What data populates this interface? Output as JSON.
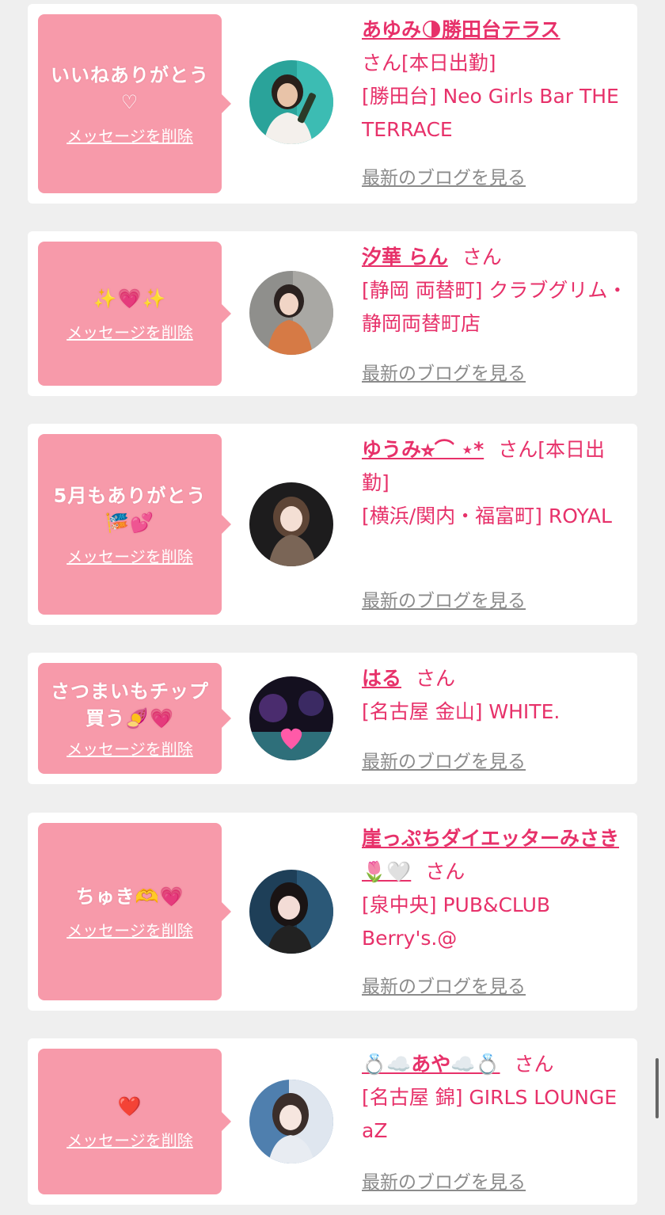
{
  "delete_label": "メッセージを削除",
  "blog_label": "最新のブログを見る",
  "san_suffix": "さん",
  "colors": {
    "page_bg": "#efefef",
    "card_bg": "#ffffff",
    "bubble": "#f79aaa",
    "accent": "#e7316a",
    "link_gray": "#8b8b8b"
  },
  "messages": [
    {
      "message": "いいねありがとう♡",
      "name": "あゆみ🌗勝田台テラス",
      "tag": "[本日出勤]",
      "shop": "[勝田台] Neo Girls Bar THE TERRACE",
      "avatar_icon": "woman-with-champagne-photo"
    },
    {
      "message": "✨💗✨",
      "name": "汐華 らん",
      "tag": "",
      "shop": "[静岡 両替町] クラブグリム・静岡両替町店",
      "avatar_icon": "woman-orange-dress-photo"
    },
    {
      "message": "5月もありがとう🎏💕",
      "name": "ゆうみ⭐︎⌒ ⋆*",
      "tag": "[本日出勤]",
      "shop": "[横浜/関内・福富町] ROYAL",
      "avatar_icon": "woman-long-hair-photo"
    },
    {
      "message": "さつまいもチップ買う🍠💗",
      "name": "はる",
      "tag": "",
      "shop": "[名古屋 金山] WHITE.",
      "avatar_icon": "night-palm-heart-photo"
    },
    {
      "message": "ちゅき🫶💗",
      "name": "崖っぷちダイエッターみさき🌷🤍",
      "tag": "",
      "shop": "[泉中央] PUB&CLUB Berry's.@",
      "avatar_icon": "woman-bangs-photo"
    },
    {
      "message": "❤️",
      "name": "💍☁️あや☁️💍",
      "tag": "",
      "shop": "[名古屋 錦] GIRLS LOUNGE aZ",
      "avatar_icon": "woman-selfie-photo"
    }
  ]
}
